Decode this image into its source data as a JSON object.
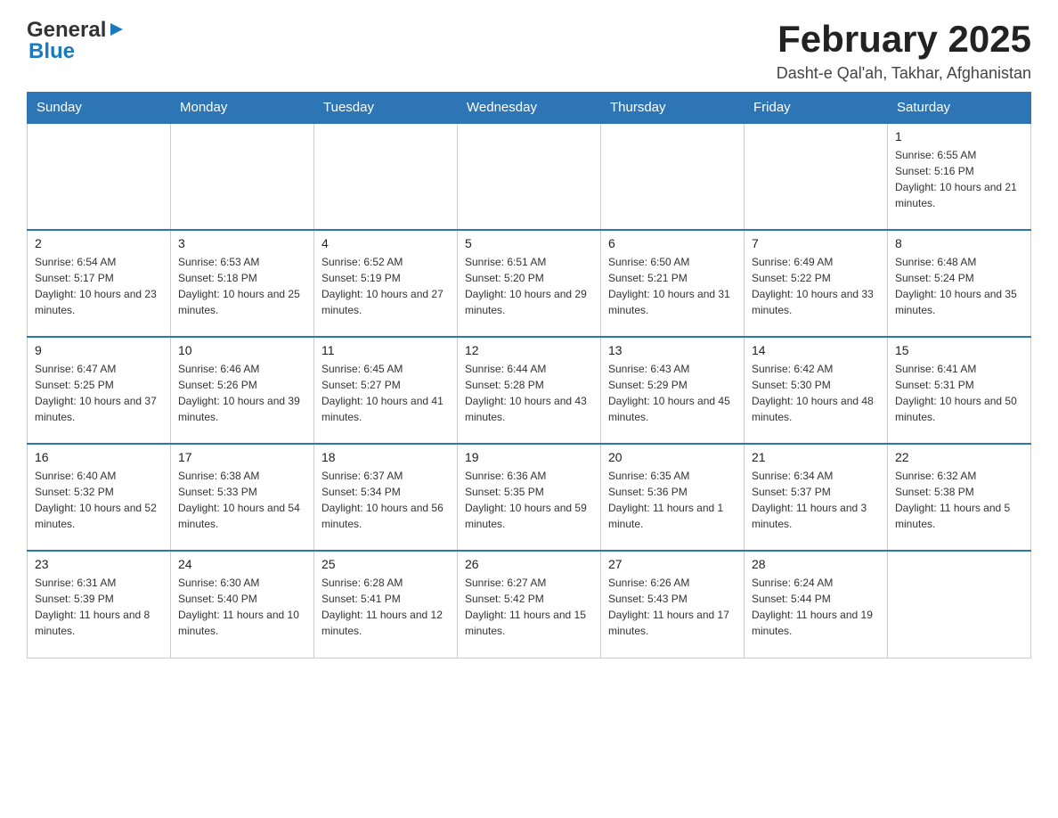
{
  "header": {
    "logo": {
      "text_general": "General",
      "text_blue": "Blue"
    },
    "title": "February 2025",
    "subtitle": "Dasht-e Qal'ah, Takhar, Afghanistan"
  },
  "days_of_week": [
    "Sunday",
    "Monday",
    "Tuesday",
    "Wednesday",
    "Thursday",
    "Friday",
    "Saturday"
  ],
  "weeks": [
    [
      {
        "day": "",
        "info": ""
      },
      {
        "day": "",
        "info": ""
      },
      {
        "day": "",
        "info": ""
      },
      {
        "day": "",
        "info": ""
      },
      {
        "day": "",
        "info": ""
      },
      {
        "day": "",
        "info": ""
      },
      {
        "day": "1",
        "info": "Sunrise: 6:55 AM\nSunset: 5:16 PM\nDaylight: 10 hours and 21 minutes."
      }
    ],
    [
      {
        "day": "2",
        "info": "Sunrise: 6:54 AM\nSunset: 5:17 PM\nDaylight: 10 hours and 23 minutes."
      },
      {
        "day": "3",
        "info": "Sunrise: 6:53 AM\nSunset: 5:18 PM\nDaylight: 10 hours and 25 minutes."
      },
      {
        "day": "4",
        "info": "Sunrise: 6:52 AM\nSunset: 5:19 PM\nDaylight: 10 hours and 27 minutes."
      },
      {
        "day": "5",
        "info": "Sunrise: 6:51 AM\nSunset: 5:20 PM\nDaylight: 10 hours and 29 minutes."
      },
      {
        "day": "6",
        "info": "Sunrise: 6:50 AM\nSunset: 5:21 PM\nDaylight: 10 hours and 31 minutes."
      },
      {
        "day": "7",
        "info": "Sunrise: 6:49 AM\nSunset: 5:22 PM\nDaylight: 10 hours and 33 minutes."
      },
      {
        "day": "8",
        "info": "Sunrise: 6:48 AM\nSunset: 5:24 PM\nDaylight: 10 hours and 35 minutes."
      }
    ],
    [
      {
        "day": "9",
        "info": "Sunrise: 6:47 AM\nSunset: 5:25 PM\nDaylight: 10 hours and 37 minutes."
      },
      {
        "day": "10",
        "info": "Sunrise: 6:46 AM\nSunset: 5:26 PM\nDaylight: 10 hours and 39 minutes."
      },
      {
        "day": "11",
        "info": "Sunrise: 6:45 AM\nSunset: 5:27 PM\nDaylight: 10 hours and 41 minutes."
      },
      {
        "day": "12",
        "info": "Sunrise: 6:44 AM\nSunset: 5:28 PM\nDaylight: 10 hours and 43 minutes."
      },
      {
        "day": "13",
        "info": "Sunrise: 6:43 AM\nSunset: 5:29 PM\nDaylight: 10 hours and 45 minutes."
      },
      {
        "day": "14",
        "info": "Sunrise: 6:42 AM\nSunset: 5:30 PM\nDaylight: 10 hours and 48 minutes."
      },
      {
        "day": "15",
        "info": "Sunrise: 6:41 AM\nSunset: 5:31 PM\nDaylight: 10 hours and 50 minutes."
      }
    ],
    [
      {
        "day": "16",
        "info": "Sunrise: 6:40 AM\nSunset: 5:32 PM\nDaylight: 10 hours and 52 minutes."
      },
      {
        "day": "17",
        "info": "Sunrise: 6:38 AM\nSunset: 5:33 PM\nDaylight: 10 hours and 54 minutes."
      },
      {
        "day": "18",
        "info": "Sunrise: 6:37 AM\nSunset: 5:34 PM\nDaylight: 10 hours and 56 minutes."
      },
      {
        "day": "19",
        "info": "Sunrise: 6:36 AM\nSunset: 5:35 PM\nDaylight: 10 hours and 59 minutes."
      },
      {
        "day": "20",
        "info": "Sunrise: 6:35 AM\nSunset: 5:36 PM\nDaylight: 11 hours and 1 minute."
      },
      {
        "day": "21",
        "info": "Sunrise: 6:34 AM\nSunset: 5:37 PM\nDaylight: 11 hours and 3 minutes."
      },
      {
        "day": "22",
        "info": "Sunrise: 6:32 AM\nSunset: 5:38 PM\nDaylight: 11 hours and 5 minutes."
      }
    ],
    [
      {
        "day": "23",
        "info": "Sunrise: 6:31 AM\nSunset: 5:39 PM\nDaylight: 11 hours and 8 minutes."
      },
      {
        "day": "24",
        "info": "Sunrise: 6:30 AM\nSunset: 5:40 PM\nDaylight: 11 hours and 10 minutes."
      },
      {
        "day": "25",
        "info": "Sunrise: 6:28 AM\nSunset: 5:41 PM\nDaylight: 11 hours and 12 minutes."
      },
      {
        "day": "26",
        "info": "Sunrise: 6:27 AM\nSunset: 5:42 PM\nDaylight: 11 hours and 15 minutes."
      },
      {
        "day": "27",
        "info": "Sunrise: 6:26 AM\nSunset: 5:43 PM\nDaylight: 11 hours and 17 minutes."
      },
      {
        "day": "28",
        "info": "Sunrise: 6:24 AM\nSunset: 5:44 PM\nDaylight: 11 hours and 19 minutes."
      },
      {
        "day": "",
        "info": ""
      }
    ]
  ]
}
